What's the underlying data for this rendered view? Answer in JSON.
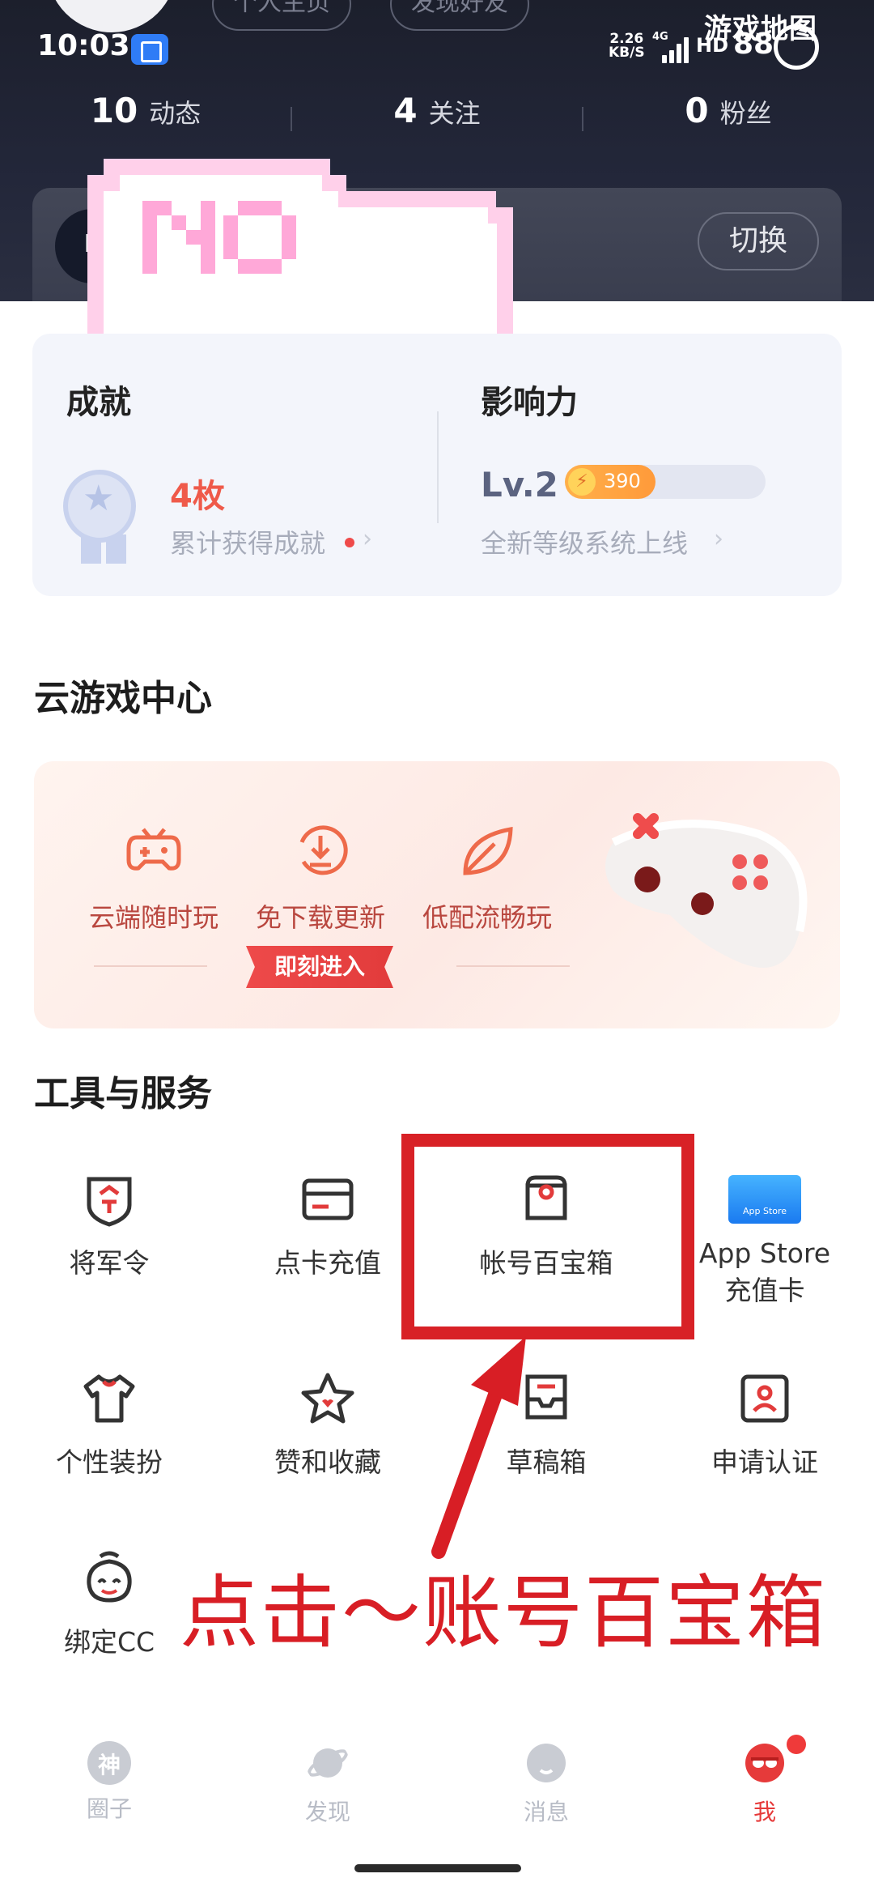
{
  "status_bar": {
    "time": "10:03",
    "net_speed": "2.26",
    "net_unit": "KB/S",
    "signal_label": "4G",
    "hd_label": "HD",
    "battery": "88",
    "watermark": "游戏地图"
  },
  "header": {
    "btn_profile": "个人主页",
    "btn_find_friends": "发现好友",
    "stats": [
      {
        "num": "10",
        "label": "动态"
      },
      {
        "num": "4",
        "label": "关注"
      },
      {
        "num": "0",
        "label": "粉丝"
      }
    ],
    "switch_label": "切换",
    "sticker_text": "NO"
  },
  "achievements": {
    "title": "成就",
    "count": "4枚",
    "subtitle": "累计获得成就",
    "influence_title": "影响力",
    "level": "Lv.2",
    "points": "390",
    "points_fraction": 0.45,
    "level_subtitle": "全新等级系统上线"
  },
  "cloud": {
    "title": "云游戏中心",
    "items": [
      "云端随时玩",
      "免下载更新",
      "低配流畅玩"
    ],
    "enter_label": "即刻进入"
  },
  "tools": {
    "title": "工具与服务",
    "items": [
      {
        "label": "将军令",
        "icon": "token-shield-icon"
      },
      {
        "label": "点卡充值",
        "icon": "card-icon"
      },
      {
        "label": "帐号百宝箱",
        "icon": "treasure-box-icon"
      },
      {
        "label": "App Store\n充值卡",
        "icon": "app-store-icon"
      },
      {
        "label": "个性装扮",
        "icon": "tshirt-icon"
      },
      {
        "label": "赞和收藏",
        "icon": "star-icon"
      },
      {
        "label": "草稿箱",
        "icon": "drafts-icon"
      },
      {
        "label": "申请认证",
        "icon": "verify-icon"
      },
      {
        "label": "绑定CC",
        "icon": "cc-icon"
      }
    ],
    "app_store_tile": "App Store"
  },
  "annotation": {
    "text": "点击～账号百宝箱",
    "color": "#d81e25"
  },
  "bottom_nav": {
    "items": [
      {
        "label": "圈子",
        "icon": "circle-icon",
        "active": false
      },
      {
        "label": "发现",
        "icon": "planet-icon",
        "active": false
      },
      {
        "label": "消息",
        "icon": "message-icon",
        "active": false
      },
      {
        "label": "我",
        "icon": "me-icon",
        "active": true
      }
    ],
    "active_color": "#e63a3a",
    "inactive_color": "#b8bcc6"
  }
}
